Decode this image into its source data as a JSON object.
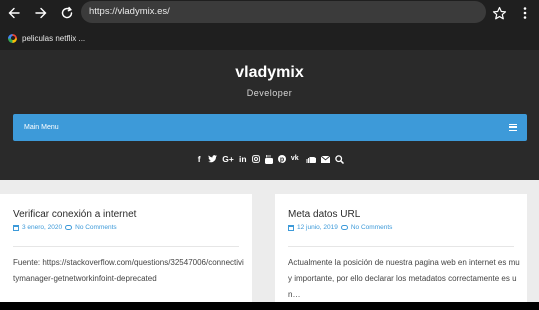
{
  "browser": {
    "url": "https://vladymix.es/",
    "bookmark": "peliculas netflix ..."
  },
  "site": {
    "title": "vladymix",
    "description": "Developer",
    "menu_label": "Main Menu",
    "social_icons": [
      "facebook-icon",
      "twitter-icon",
      "google-plus-icon",
      "linkedin-icon",
      "instagram-icon",
      "youtube-icon",
      "pinterest-icon",
      "vk-icon",
      "soundcloud-icon",
      "email-icon",
      "search-icon"
    ]
  },
  "posts": [
    {
      "title": "Verificar conexión a internet",
      "date": "3 enero, 2020",
      "comments": "No Comments",
      "excerpt": "Fuente: https://stackoverflow.com/questions/32547006/connectivitymanager-getnetworkinfoint-deprecated"
    },
    {
      "title": "Meta datos URL",
      "date": "12 junio, 2019",
      "comments": "No Comments",
      "excerpt": "Actualmente la posición de nuestra pagina web en internet es muy importante, por ello declarar los metadatos correctamente es un…"
    }
  ]
}
